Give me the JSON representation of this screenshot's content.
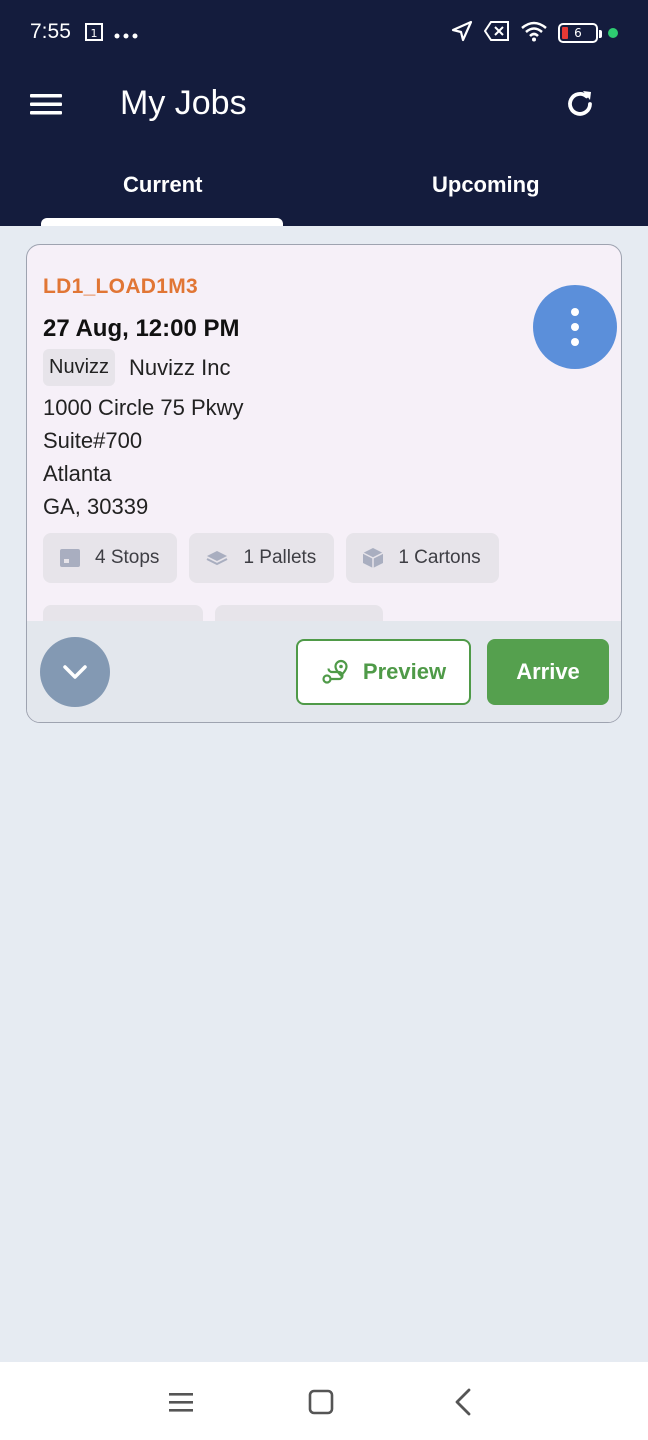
{
  "status_bar": {
    "time": "7:55",
    "battery_level": "6",
    "icons": [
      "calendar-icon",
      "more-dots-icon",
      "location-arrow-icon",
      "sim-off-icon",
      "wifi-icon",
      "battery-icon",
      "active-dot-icon"
    ]
  },
  "app_bar": {
    "title": "My Jobs",
    "menu_icon": "hamburger-menu-icon",
    "refresh_icon": "refresh-icon"
  },
  "tabs": [
    {
      "label": "Current",
      "active": true
    },
    {
      "label": "Upcoming",
      "active": false
    }
  ],
  "job": {
    "id": "LD1_LOAD1M3",
    "datetime": "27 Aug, 12:00 PM",
    "tag": "Nuvizz",
    "company": "Nuvizz Inc",
    "address_line1": "1000 Circle 75 Pkwy",
    "address_line2": "Suite#700",
    "city": "Atlanta",
    "state_zip": "GA, 30339",
    "chips": [
      {
        "icon": "stops-box-icon",
        "label": "4 Stops"
      },
      {
        "icon": "pallet-icon",
        "label": "1 Pallets"
      },
      {
        "icon": "carton-icon",
        "label": "1 Cartons"
      }
    ],
    "preview_label": "Preview",
    "arrive_label": "Arrive"
  },
  "colors": {
    "header_bg": "#141c3d",
    "page_bg": "#e6ebf2",
    "job_id": "#e17635",
    "more_button": "#5b8fda",
    "action_green": "#55a04e",
    "expand_button": "#8399b3"
  }
}
